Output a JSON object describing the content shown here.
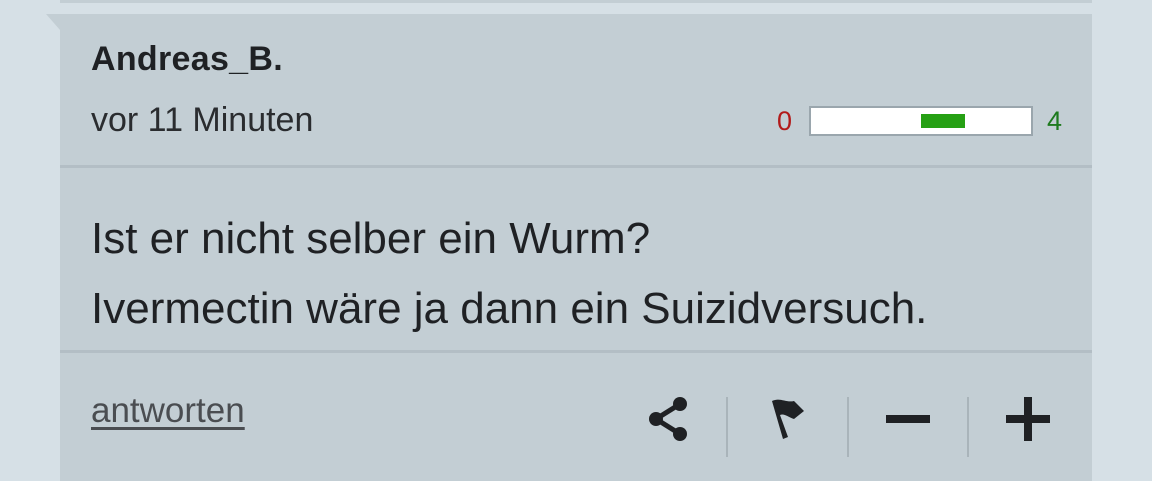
{
  "comment": {
    "author": "Andreas_B.",
    "timestamp": "vor 11 Minuten",
    "rating": {
      "negative": "0",
      "positive": "4",
      "bar_fill_start_fraction": 0.5,
      "bar_fill_end_fraction": 0.7,
      "negative_color": "#b21a1a",
      "positive_color": "#1e7a1e",
      "fill_color": "#26a014"
    },
    "body_lines": [
      "Ist er nicht selber ein Wurm?",
      "Ivermectin wäre ja dann ein Suizidversuch."
    ]
  },
  "footer": {
    "reply_label": "antworten",
    "actions": [
      {
        "name": "share",
        "icon": "share-icon"
      },
      {
        "name": "flag",
        "icon": "flag-icon"
      },
      {
        "name": "downvote",
        "icon": "minus-icon"
      },
      {
        "name": "upvote",
        "icon": "plus-icon"
      }
    ]
  },
  "colors": {
    "page_background": "#d6e0e6",
    "card_background": "#c3ced4",
    "divider": "#b3bec5",
    "text": "#1f2124"
  }
}
